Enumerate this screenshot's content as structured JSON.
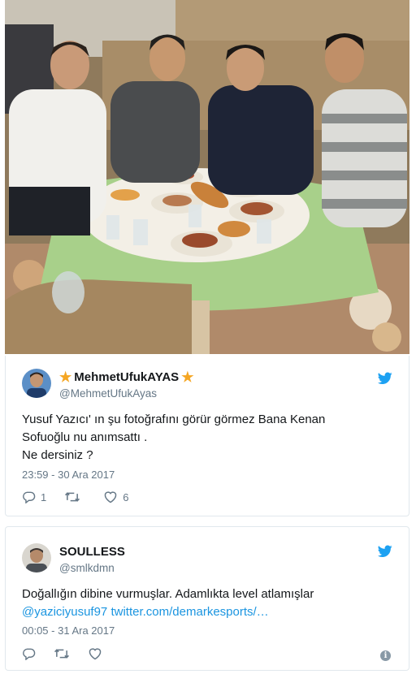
{
  "photo": {
    "icon": "photo"
  },
  "tweets": [
    {
      "display_name": "MehmetUfukAYAS",
      "handle": "@MehmetUfukAyas",
      "text_lines": [
        "Yusuf Yazıcı' ın şu fotoğrafını görür görmez Bana Kenan",
        "Sofuoğlu nu anımsattı .",
        "Ne dersiniz ?"
      ],
      "timestamp": "23:59 - 30 Ara 2017",
      "reply_count": "1",
      "retweet_count": "",
      "like_count": "6"
    },
    {
      "display_name": "SOULLESS",
      "handle": "@smlkdmn",
      "text_line1": "Doğallığın dibine vurmuşlar. Adamlıkta level atlamışlar",
      "mention": "@yaziciyusuf97",
      "link": "twitter.com/demarkesports/…",
      "timestamp": "00:05 - 31 Ara 2017",
      "info_icon": "i"
    }
  ],
  "colors": {
    "link": "#1b95e0",
    "muted": "#657786",
    "star": "#f5a623",
    "twitter_blue": "#1da1f2"
  }
}
